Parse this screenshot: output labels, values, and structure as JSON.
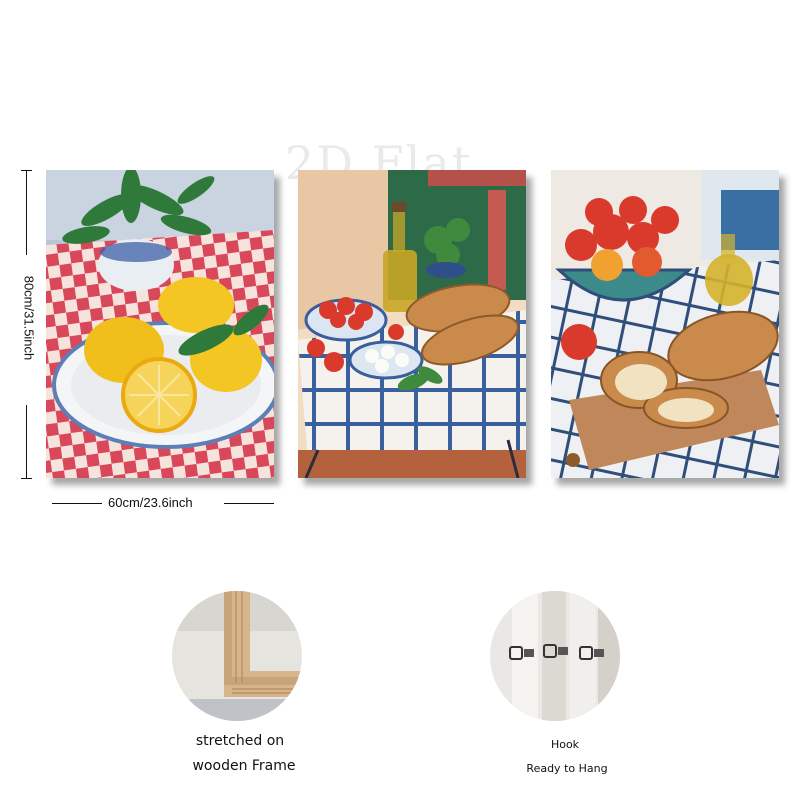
{
  "watermark": "2D Flat",
  "dimensions": {
    "height_label": "80cm/31.5inch",
    "width_label": "60cm/23.6inch"
  },
  "panels": [
    {
      "subject": "lemons-plate"
    },
    {
      "subject": "tomatoes-bread-oil"
    },
    {
      "subject": "tomato-bowl-bread"
    }
  ],
  "features": {
    "frame": {
      "line1": "stretched on",
      "line2": "wooden Frame"
    },
    "hook": {
      "line1": "Hook",
      "line2": "Ready to Hang"
    }
  },
  "colors": {
    "checker_red": "#d9485a",
    "lemon": "#f3c623",
    "tomato": "#d93a2b",
    "bread": "#c98a4c",
    "blue_check": "#3a5f9e",
    "wood": "#c9a47a"
  }
}
